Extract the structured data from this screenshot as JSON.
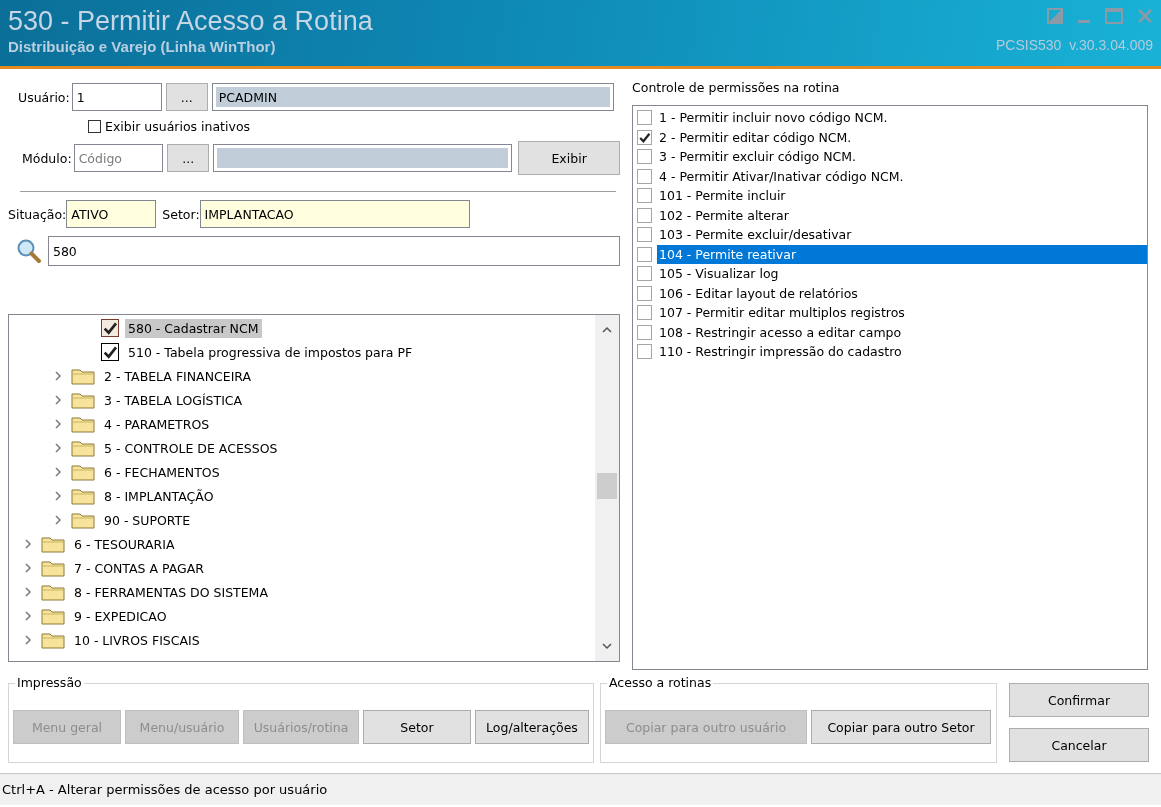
{
  "window": {
    "title": "530 - Permitir Acesso a Rotina",
    "subtitle": "Distribuição e Varejo (Linha WinThor)",
    "version": "PCSIS530  v.30.3.04.009"
  },
  "user": {
    "label": "Usuário:",
    "code": "1",
    "browse": "...",
    "name": "PCADMIN"
  },
  "show_inactive": {
    "label": "Exibir usuários inativos",
    "checked": false
  },
  "module": {
    "label": "Módulo:",
    "placeholder": "Código",
    "browse": "...",
    "button": "Exibir"
  },
  "situation": {
    "label": "Situação:",
    "value": "ATIVO"
  },
  "sector": {
    "label": "Setor:",
    "value": "IMPLANTACAO"
  },
  "search": {
    "value": "580"
  },
  "tree": {
    "nodes": [
      {
        "kind": "hidden",
        "children": [
          {
            "kind": "hidden",
            "children": [
              {
                "kind": "check",
                "label": "580 - Cadastrar  NCM",
                "checked": true,
                "selected": true
              },
              {
                "kind": "check",
                "label": "510 - Tabela progressiva de impostos para PF",
                "checked": true,
                "selected": false
              }
            ]
          },
          {
            "kind": "folder",
            "label": "2 - TABELA FINANCEIRA",
            "expanded": false
          },
          {
            "kind": "folder",
            "label": "3 - TABELA LOGÍSTICA",
            "expanded": false
          },
          {
            "kind": "folder",
            "label": "4 - PARAMETROS",
            "expanded": false
          },
          {
            "kind": "folder",
            "label": "5 - CONTROLE DE ACESSOS",
            "expanded": false
          },
          {
            "kind": "folder",
            "label": "6 - FECHAMENTOS",
            "expanded": false
          },
          {
            "kind": "folder",
            "label": "8 - IMPLANTAÇÃO",
            "expanded": false
          },
          {
            "kind": "folder",
            "label": "90 - SUPORTE",
            "expanded": false
          }
        ]
      },
      {
        "kind": "folder",
        "label": "6 - TESOURARIA",
        "expanded": false
      },
      {
        "kind": "folder",
        "label": "7 - CONTAS A PAGAR",
        "expanded": false
      },
      {
        "kind": "folder",
        "label": "8 - FERRAMENTAS DO SISTEMA",
        "expanded": false
      },
      {
        "kind": "folder",
        "label": "9 - EXPEDICAO",
        "expanded": false
      },
      {
        "kind": "folder",
        "label": "10 - LIVROS FISCAIS",
        "expanded": false
      }
    ]
  },
  "permissions": {
    "title": "Controle de permissões na rotina",
    "items": [
      {
        "label": "1 - Permitir incluir novo código NCM.",
        "checked": false,
        "selected": false
      },
      {
        "label": "2 - Permitir editar código NCM.",
        "checked": true,
        "selected": false
      },
      {
        "label": "3 - Permitir excluir código NCM.",
        "checked": false,
        "selected": false
      },
      {
        "label": "4 - Permitir Ativar/Inativar código NCM.",
        "checked": false,
        "selected": false
      },
      {
        "label": "101 - Permite incluir",
        "checked": false,
        "selected": false
      },
      {
        "label": "102 - Permite alterar",
        "checked": false,
        "selected": false
      },
      {
        "label": "103 - Permite excluir/desativar",
        "checked": false,
        "selected": false
      },
      {
        "label": "104 - Permite reativar",
        "checked": false,
        "selected": true
      },
      {
        "label": "105 - Visualizar log",
        "checked": false,
        "selected": false
      },
      {
        "label": "106 - Editar layout de relatórios",
        "checked": false,
        "selected": false
      },
      {
        "label": "107 - Permitir editar multiplos registros",
        "checked": false,
        "selected": false
      },
      {
        "label": "108 - Restringir acesso a editar campo",
        "checked": false,
        "selected": false
      },
      {
        "label": "110 - Restringir impressão do cadastro",
        "checked": false,
        "selected": false
      }
    ]
  },
  "print_group": {
    "title": "Impressão",
    "buttons": [
      {
        "label": "Menu geral",
        "disabled": true
      },
      {
        "label": "Menu/usuário",
        "disabled": true
      },
      {
        "label": "Usuários/rotina",
        "disabled": true
      },
      {
        "label": "Setor",
        "disabled": false
      },
      {
        "label": "Log/alterações",
        "disabled": false
      }
    ]
  },
  "access_group": {
    "title": "Acesso a rotinas",
    "buttons": [
      {
        "label": "Copiar para outro usuário",
        "disabled": true
      },
      {
        "label": "Copiar para outro Setor",
        "disabled": false
      }
    ]
  },
  "actions": [
    {
      "label": "Confirmar",
      "disabled": false
    },
    {
      "label": "Cancelar",
      "disabled": false
    }
  ],
  "status_bar": "Ctrl+A - Alterar permissões de acesso por usuário"
}
